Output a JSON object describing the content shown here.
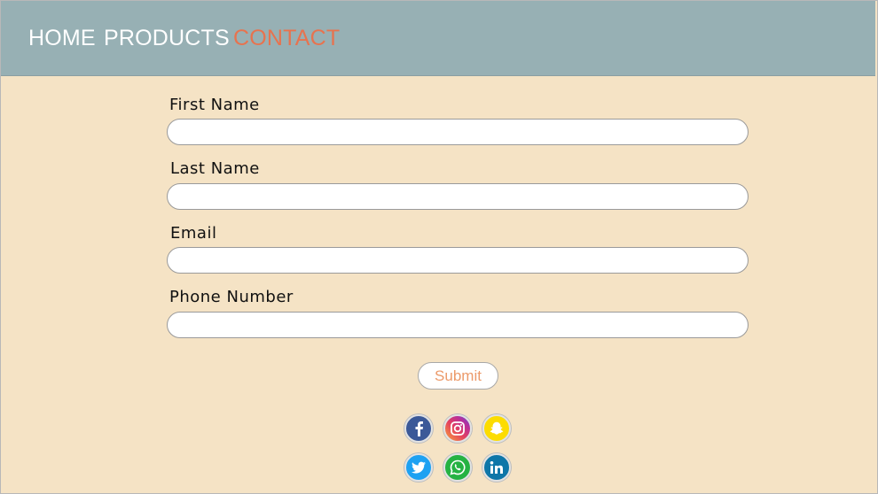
{
  "nav": {
    "home": "HOME",
    "products": "PRODUCTS",
    "contact": "CONTACT",
    "active_color": "#e7734f"
  },
  "form": {
    "first_name_label": "First Name",
    "first_name_value": "",
    "last_name_label": "Last Name",
    "last_name_value": "",
    "email_label": "Email",
    "email_value": "",
    "phone_label": "Phone Number",
    "phone_value": "",
    "submit_label": "Submit"
  },
  "social": {
    "icons": [
      "facebook-icon",
      "instagram-icon",
      "snapchat-icon",
      "twitter-icon",
      "whatsapp-icon",
      "linkedin-icon"
    ]
  },
  "colors": {
    "page_background": "#f5e3c5",
    "navbar": "#97b0b4",
    "submit_text": "#ec9a6a"
  }
}
